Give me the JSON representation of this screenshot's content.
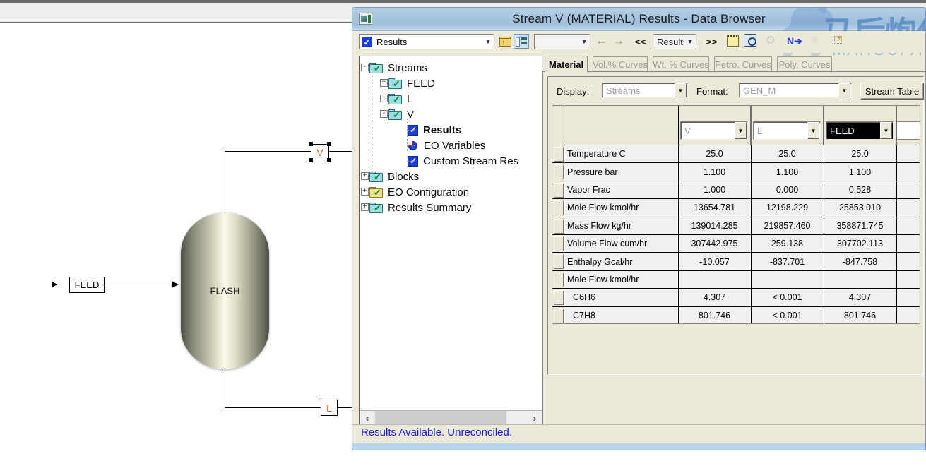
{
  "window": {
    "title": "Stream V (MATERIAL) Results - Data Browser",
    "icon": "data-browser-icon"
  },
  "watermark": {
    "chinese": "马后炮化工",
    "english": "MAHOUPAQ"
  },
  "toolbar": {
    "object_combo_value": "Results",
    "checkbox_state": "checked",
    "folder_up_icon": "folder-up-icon",
    "tree_view_icon": "tree-list-icon",
    "secondary_combo_value": "",
    "back_icon": "back-arrow-icon",
    "forward_icon": "forward-arrow-icon",
    "prev_chevron": "<<",
    "nav_combo_value": "Results",
    "next_chevron": ">>",
    "note_icon": "note-icon",
    "inspect_icon": "inspect-magnifier-icon",
    "gear_icon": "gear-icon",
    "next_input_icon": "n-arrow-icon",
    "sparkle_icon": "sparkle-icon",
    "wand_icon": "wand-icon"
  },
  "tree": {
    "nodes": [
      {
        "label": "Streams",
        "level": 0,
        "expander": "-",
        "icon": "folder-check-cyan-icon",
        "bold": false
      },
      {
        "label": "FEED",
        "level": 1,
        "expander": "+",
        "icon": "folder-check-cyan-icon",
        "bold": false
      },
      {
        "label": "L",
        "level": 1,
        "expander": "+",
        "icon": "folder-check-cyan-icon",
        "bold": false
      },
      {
        "label": "V",
        "level": 1,
        "expander": "-",
        "icon": "folder-check-cyan-icon",
        "bold": false
      },
      {
        "label": "Results",
        "level": 2,
        "expander": "",
        "icon": "checkbox-blue-icon",
        "bold": true
      },
      {
        "label": "EO Variables",
        "level": 2,
        "expander": "",
        "icon": "pie-chart-icon",
        "bold": false
      },
      {
        "label": "Custom Stream Res",
        "level": 2,
        "expander": "",
        "icon": "checkbox-blue-icon",
        "bold": false
      },
      {
        "label": "Blocks",
        "level": 0,
        "expander": "+",
        "icon": "folder-check-cyan-icon",
        "bold": false
      },
      {
        "label": "EO Configuration",
        "level": 0,
        "expander": "+",
        "icon": "folder-check-yellow-icon",
        "bold": false
      },
      {
        "label": "Results Summary",
        "level": 0,
        "expander": "+",
        "icon": "folder-check-cyan-icon",
        "bold": false
      }
    ],
    "scroll_left_arrow": "‹",
    "scroll_right_arrow": "›"
  },
  "tabs": [
    {
      "label": "Material",
      "active": true
    },
    {
      "label": "Vol.% Curves",
      "active": false
    },
    {
      "label": "Wt. % Curves",
      "active": false
    },
    {
      "label": "Petro. Curves",
      "active": false
    },
    {
      "label": "Poly. Curves",
      "active": false
    }
  ],
  "form": {
    "display_label": "Display:",
    "display_value": "Streams",
    "format_label": "Format:",
    "format_value": "GEN_M",
    "stream_table_button": "Stream Table"
  },
  "grid": {
    "column_headers": [
      "V",
      "L",
      "FEED",
      ""
    ],
    "selected_column_index": 2,
    "rows": [
      {
        "label": "Temperature C",
        "indent": false,
        "values": [
          "25.0",
          "25.0",
          "25.0",
          ""
        ]
      },
      {
        "label": "Pressure bar",
        "indent": false,
        "values": [
          "1.100",
          "1.100",
          "1.100",
          ""
        ]
      },
      {
        "label": "Vapor Frac",
        "indent": false,
        "values": [
          "1.000",
          "0.000",
          "0.528",
          ""
        ]
      },
      {
        "label": "Mole Flow kmol/hr",
        "indent": false,
        "values": [
          "13654.781",
          "12198.229",
          "25853.010",
          ""
        ]
      },
      {
        "label": "Mass Flow kg/hr",
        "indent": false,
        "values": [
          "139014.285",
          "219857.460",
          "358871.745",
          ""
        ]
      },
      {
        "label": "Volume Flow cum/hr",
        "indent": false,
        "values": [
          "307442.975",
          "259.138",
          "307702.113",
          ""
        ]
      },
      {
        "label": "Enthalpy   Gcal/hr",
        "indent": false,
        "values": [
          "-10.057",
          "-837.701",
          "-847.758",
          ""
        ]
      },
      {
        "label": "Mole Flow kmol/hr",
        "indent": false,
        "values": [
          "",
          "",
          "",
          ""
        ]
      },
      {
        "label": "C6H6",
        "indent": true,
        "values": [
          "4.307",
          "< 0.001",
          "4.307",
          ""
        ]
      },
      {
        "label": "C7H8",
        "indent": true,
        "values": [
          "801.746",
          "< 0.001",
          "801.746",
          ""
        ]
      }
    ]
  },
  "status": {
    "message": "Results Available. Unreconciled."
  },
  "flowsheet": {
    "feed_label": "FEED",
    "vessel_label": "FLASH",
    "vapor_label": "V",
    "liquid_label": "L",
    "vapor_selected": true
  }
}
